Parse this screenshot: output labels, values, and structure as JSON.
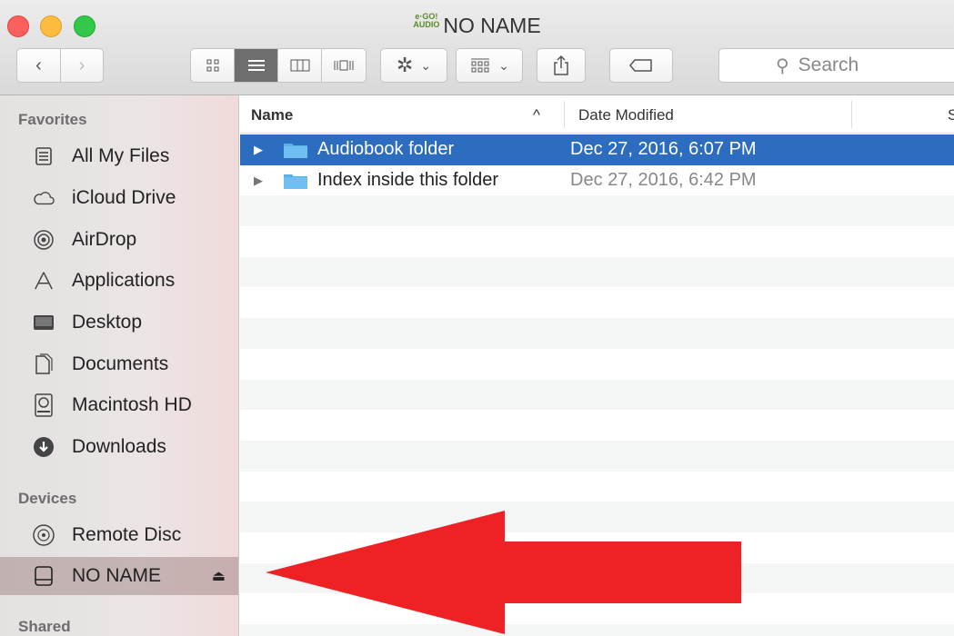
{
  "window": {
    "title": "NO NAME",
    "volume_logo": "e-GO! AUDIO"
  },
  "toolbar": {
    "back": "‹",
    "forward": "›",
    "view_icon": "▤",
    "view_column": "▥",
    "view_cover": "▯",
    "action_icon": "✲",
    "action_chevron": "⌄",
    "arrange_icon": "▦",
    "share_icon": "⇪",
    "tag_icon": "⬭",
    "search_placeholder": "Search"
  },
  "sidebar": {
    "favorites_header": "Favorites",
    "favorites": [
      {
        "label": "All My Files",
        "icon": "all-files-icon"
      },
      {
        "label": "iCloud Drive",
        "icon": "cloud-icon"
      },
      {
        "label": "AirDrop",
        "icon": "airdrop-icon"
      },
      {
        "label": "Applications",
        "icon": "applications-icon"
      },
      {
        "label": "Desktop",
        "icon": "desktop-icon"
      },
      {
        "label": "Documents",
        "icon": "documents-icon"
      },
      {
        "label": "Macintosh HD",
        "icon": "hard-drive-icon"
      },
      {
        "label": "Downloads",
        "icon": "downloads-icon"
      }
    ],
    "devices_header": "Devices",
    "devices": [
      {
        "label": "Remote Disc",
        "icon": "disc-icon"
      },
      {
        "label": "NO NAME",
        "icon": "external-drive-icon",
        "eject": "⏏"
      }
    ],
    "shared_header": "Shared"
  },
  "columns": {
    "name": "Name",
    "sort_indicator": "^",
    "date": "Date Modified",
    "size_partial": "S"
  },
  "files": [
    {
      "name": "Audiobook folder",
      "date": "Dec 27, 2016, 6:07 PM",
      "selected": true
    },
    {
      "name": "Index inside this folder",
      "date": "Dec 27, 2016, 6:42 PM",
      "selected": false
    }
  ],
  "colors": {
    "selection": "#2d6dbf",
    "arrow": "#ee2124",
    "folder": "#5ab0e8"
  }
}
